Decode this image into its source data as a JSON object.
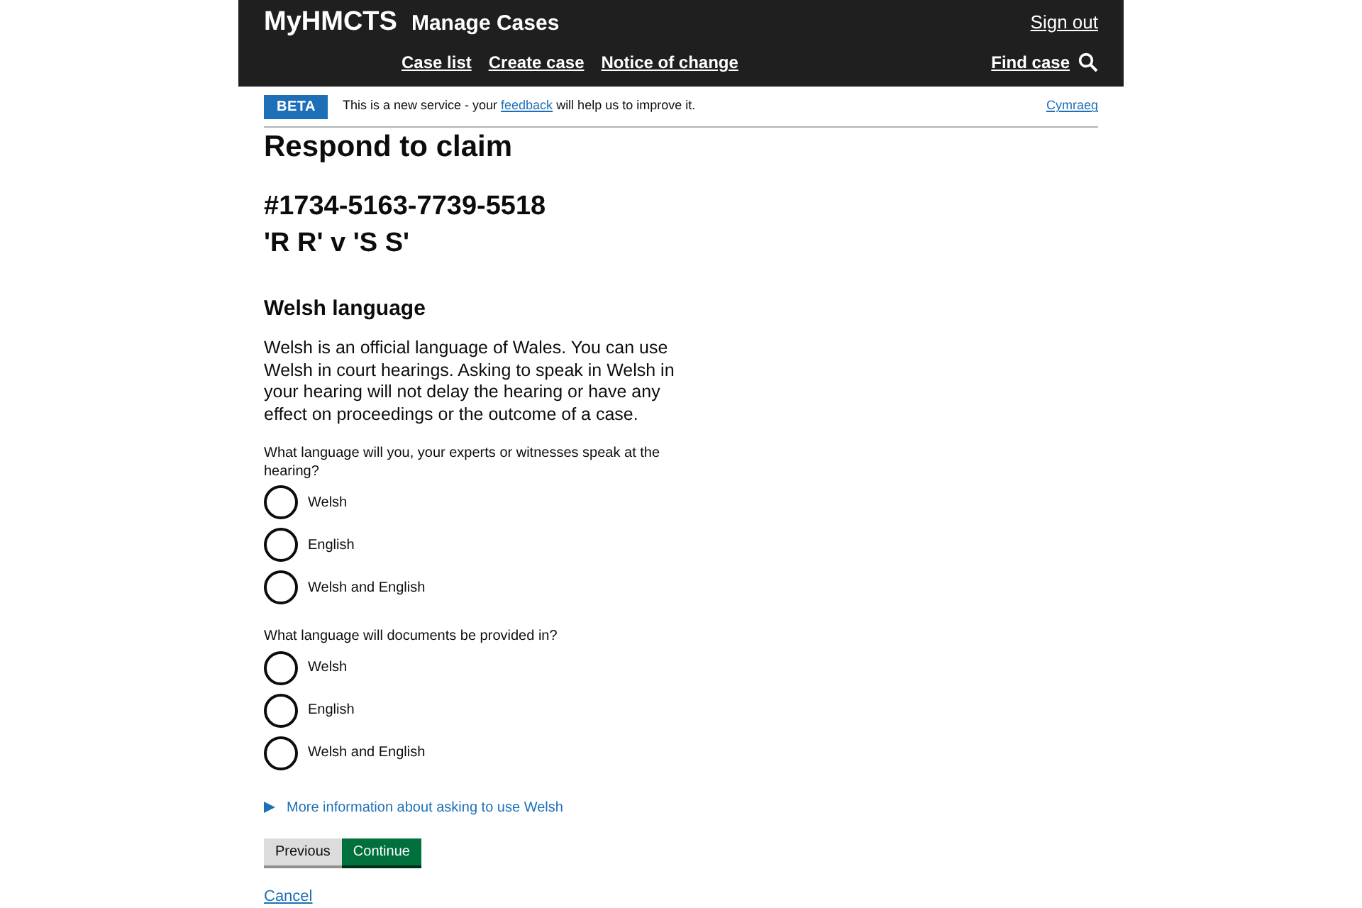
{
  "header": {
    "logo": "MyHMCTS",
    "service": "Manage Cases",
    "sign_out": "Sign out",
    "nav": [
      "Case list",
      "Create case",
      "Notice of change"
    ],
    "find_case": "Find case"
  },
  "banner": {
    "tag": "BETA",
    "text_before": "This is a new service - your ",
    "link": "feedback",
    "text_after": " will help us to improve it.",
    "language_link": "Cymraeg"
  },
  "page": {
    "title": "Respond to claim",
    "case_number": "#1734-5163-7739-5518",
    "case_name": "'R R' v 'S S'",
    "section_title": "Welsh language",
    "intro": "Welsh is an official language of Wales. You can use Welsh in court hearings. Asking to speak in Welsh in your hearing will not delay the hearing or have any effect on proceedings or the outcome of a case."
  },
  "questions": [
    {
      "label": "What language will you, your experts or witnesses speak at the hearing?",
      "options": [
        {
          "label": "Welsh",
          "selected": false
        },
        {
          "label": "English",
          "selected": false
        },
        {
          "label": "Welsh and English",
          "selected": false
        }
      ]
    },
    {
      "label": "What language will documents be provided in?",
      "options": [
        {
          "label": "Welsh",
          "selected": false
        },
        {
          "label": "English",
          "selected": false
        },
        {
          "label": "Welsh and English",
          "selected": false
        }
      ]
    }
  ],
  "details": {
    "summary": "More information about asking to use Welsh",
    "expanded": false
  },
  "buttons": {
    "previous": "Previous",
    "continue": "Continue"
  },
  "cancel": "Cancel"
}
